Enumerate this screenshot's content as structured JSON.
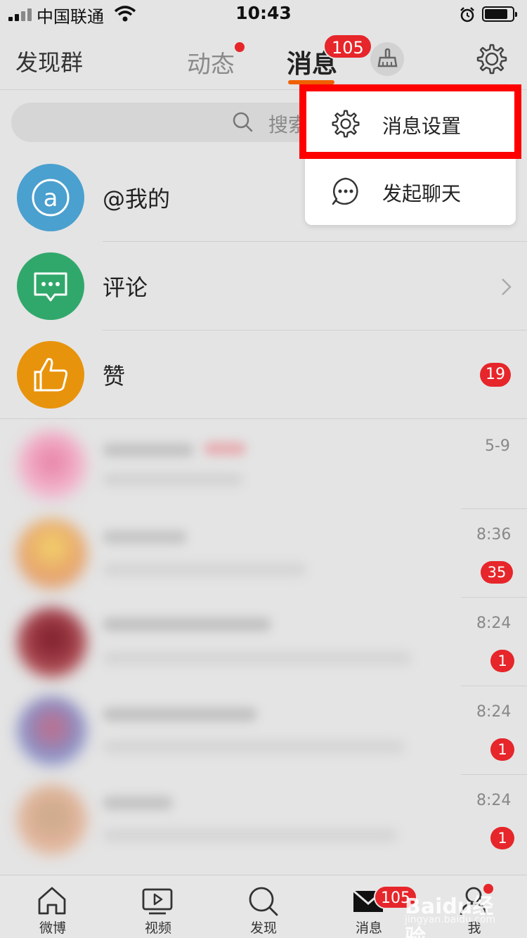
{
  "status_bar": {
    "carrier": "中国联通",
    "time": "10:43"
  },
  "nav": {
    "left_label": "发现群",
    "tabs": [
      {
        "label": "动态",
        "has_dot": true
      },
      {
        "label": "消息",
        "badge": "105",
        "active": true
      }
    ],
    "icons": [
      "broom-icon",
      "gear-icon"
    ]
  },
  "search": {
    "placeholder": "搜索"
  },
  "popup_menu": {
    "items": [
      {
        "label": "消息设置",
        "icon": "gear-icon",
        "highlighted": true
      },
      {
        "label": "发起聊天",
        "icon": "chat-bubble-icon"
      }
    ]
  },
  "list": {
    "items": [
      {
        "title": "@我的",
        "icon": "at-icon",
        "color": "#4aa0cf"
      },
      {
        "title": "评论",
        "icon": "comment-icon",
        "color": "#31a86b"
      },
      {
        "title": "赞",
        "icon": "thumbs-up-icon",
        "color": "#e8930c",
        "badge": "19"
      }
    ],
    "conversations": [
      {
        "time": "5-9",
        "badge": ""
      },
      {
        "time": "8:36",
        "badge": "35"
      },
      {
        "time": "8:24",
        "badge": "1"
      },
      {
        "time": "8:24",
        "badge": "1"
      },
      {
        "time": "8:24",
        "badge": "1"
      }
    ]
  },
  "tab_bar": {
    "items": [
      {
        "label": "微博",
        "icon": "home-icon"
      },
      {
        "label": "视频",
        "icon": "video-icon"
      },
      {
        "label": "发现",
        "icon": "search-icon"
      },
      {
        "label": "消息",
        "icon": "mail-icon",
        "badge": "105"
      },
      {
        "label": "我",
        "icon": "profile-icon"
      }
    ]
  },
  "watermark": {
    "text": "Baidu经验",
    "sub": "jingyan.baidu.com"
  },
  "colors": {
    "badge_red": "#e6262a",
    "accent_orange": "#f06000",
    "highlight_red": "#ff0000"
  }
}
